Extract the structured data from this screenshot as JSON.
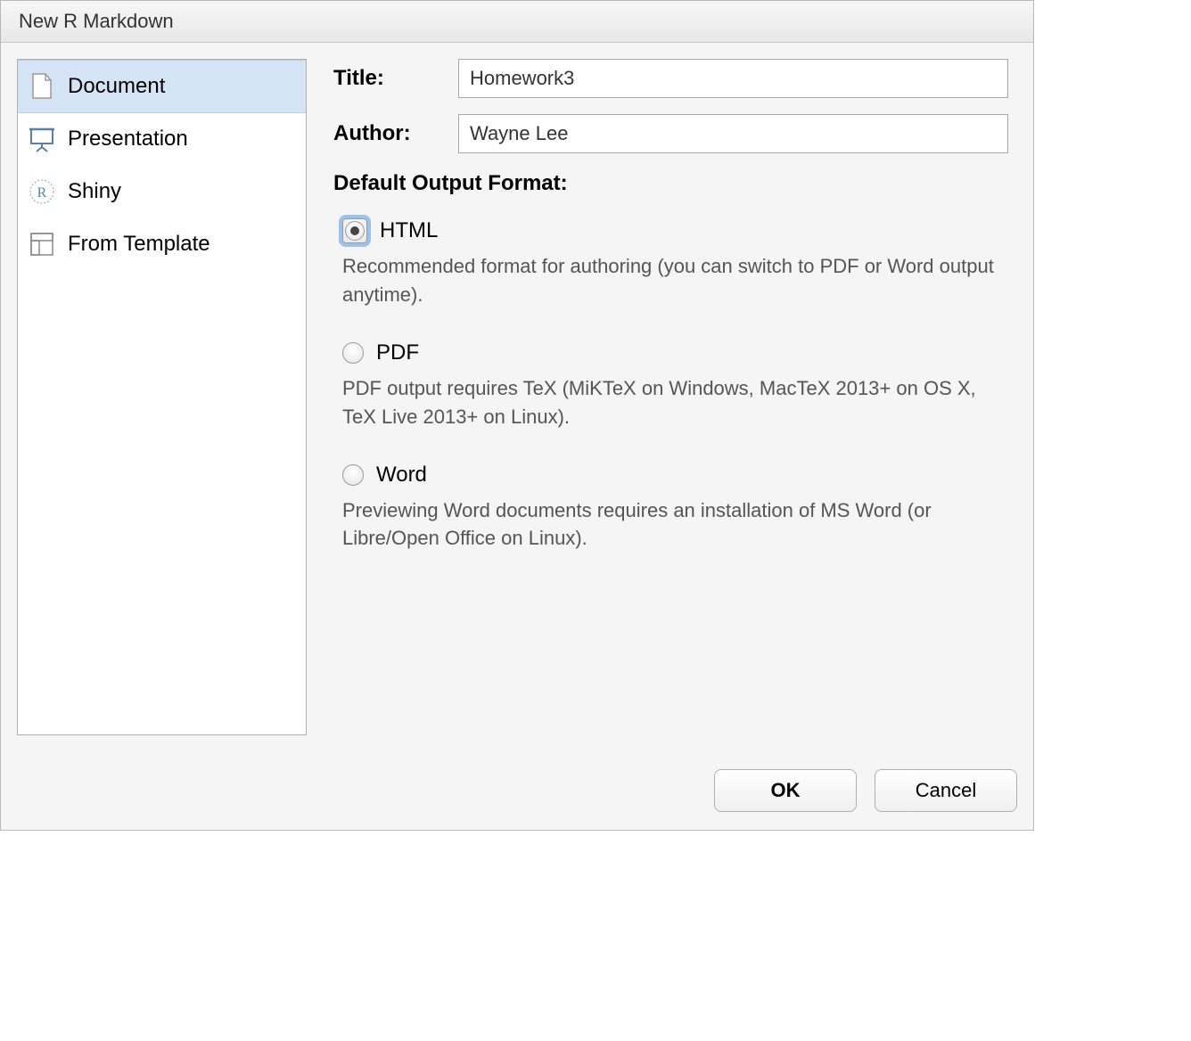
{
  "title": "New R Markdown",
  "sidebar": {
    "items": [
      {
        "label": "Document"
      },
      {
        "label": "Presentation"
      },
      {
        "label": "Shiny"
      },
      {
        "label": "From Template"
      }
    ]
  },
  "form": {
    "title_label": "Title:",
    "title_value": "Homework3",
    "author_label": "Author:",
    "author_value": "Wayne Lee"
  },
  "output": {
    "header": "Default Output Format:",
    "options": [
      {
        "label": "HTML",
        "desc": "Recommended format for authoring (you can switch to PDF or Word output anytime)."
      },
      {
        "label": "PDF",
        "desc": "PDF output requires TeX (MiKTeX on Windows, MacTeX 2013+ on OS X, TeX Live 2013+ on Linux)."
      },
      {
        "label": "Word",
        "desc": "Previewing Word documents requires an installation of MS Word (or Libre/Open Office on Linux)."
      }
    ]
  },
  "buttons": {
    "ok": "OK",
    "cancel": "Cancel"
  }
}
